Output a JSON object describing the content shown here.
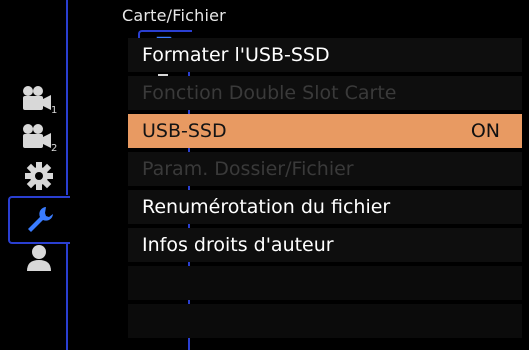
{
  "header": {
    "title": "Carte/Fichier"
  },
  "category_icons": [
    {
      "icon": "video-camera-1-icon",
      "subscript": "1"
    },
    {
      "icon": "video-camera-2-icon",
      "subscript": "2"
    },
    {
      "icon": "gear-icon"
    },
    {
      "icon": "wrench-icon",
      "active": true
    },
    {
      "icon": "person-icon"
    }
  ],
  "tab_icons": [
    {
      "icon": "card-file-icon",
      "active": true
    },
    {
      "icon": "monitor-icon"
    },
    {
      "icon": "wireless-connection-icon"
    },
    {
      "icon": "wireless-settings-icon"
    },
    {
      "icon": "gear-icon"
    },
    {
      "icon": "wrench-dots-icon"
    },
    {
      "icon": "wrench-dots-icon"
    }
  ],
  "menu": {
    "items": [
      {
        "label": "Formater l'USB-SSD",
        "value": "",
        "state": "normal"
      },
      {
        "label": "Fonction Double Slot Carte",
        "value": "",
        "state": "disabled"
      },
      {
        "label": "USB-SSD",
        "value": "ON",
        "state": "selected"
      },
      {
        "label": "Param. Dossier/Fichier",
        "value": "",
        "state": "disabled"
      },
      {
        "label": "Renumérotation du fichier",
        "value": "",
        "state": "normal"
      },
      {
        "label": "Infos droits d'auteur",
        "value": "",
        "state": "normal"
      }
    ]
  },
  "colors": {
    "accent_frame": "#2a3fd1",
    "selected_row": "#e89a62",
    "active_icon": "#3a7cff",
    "icon": "#d8d8d8"
  }
}
